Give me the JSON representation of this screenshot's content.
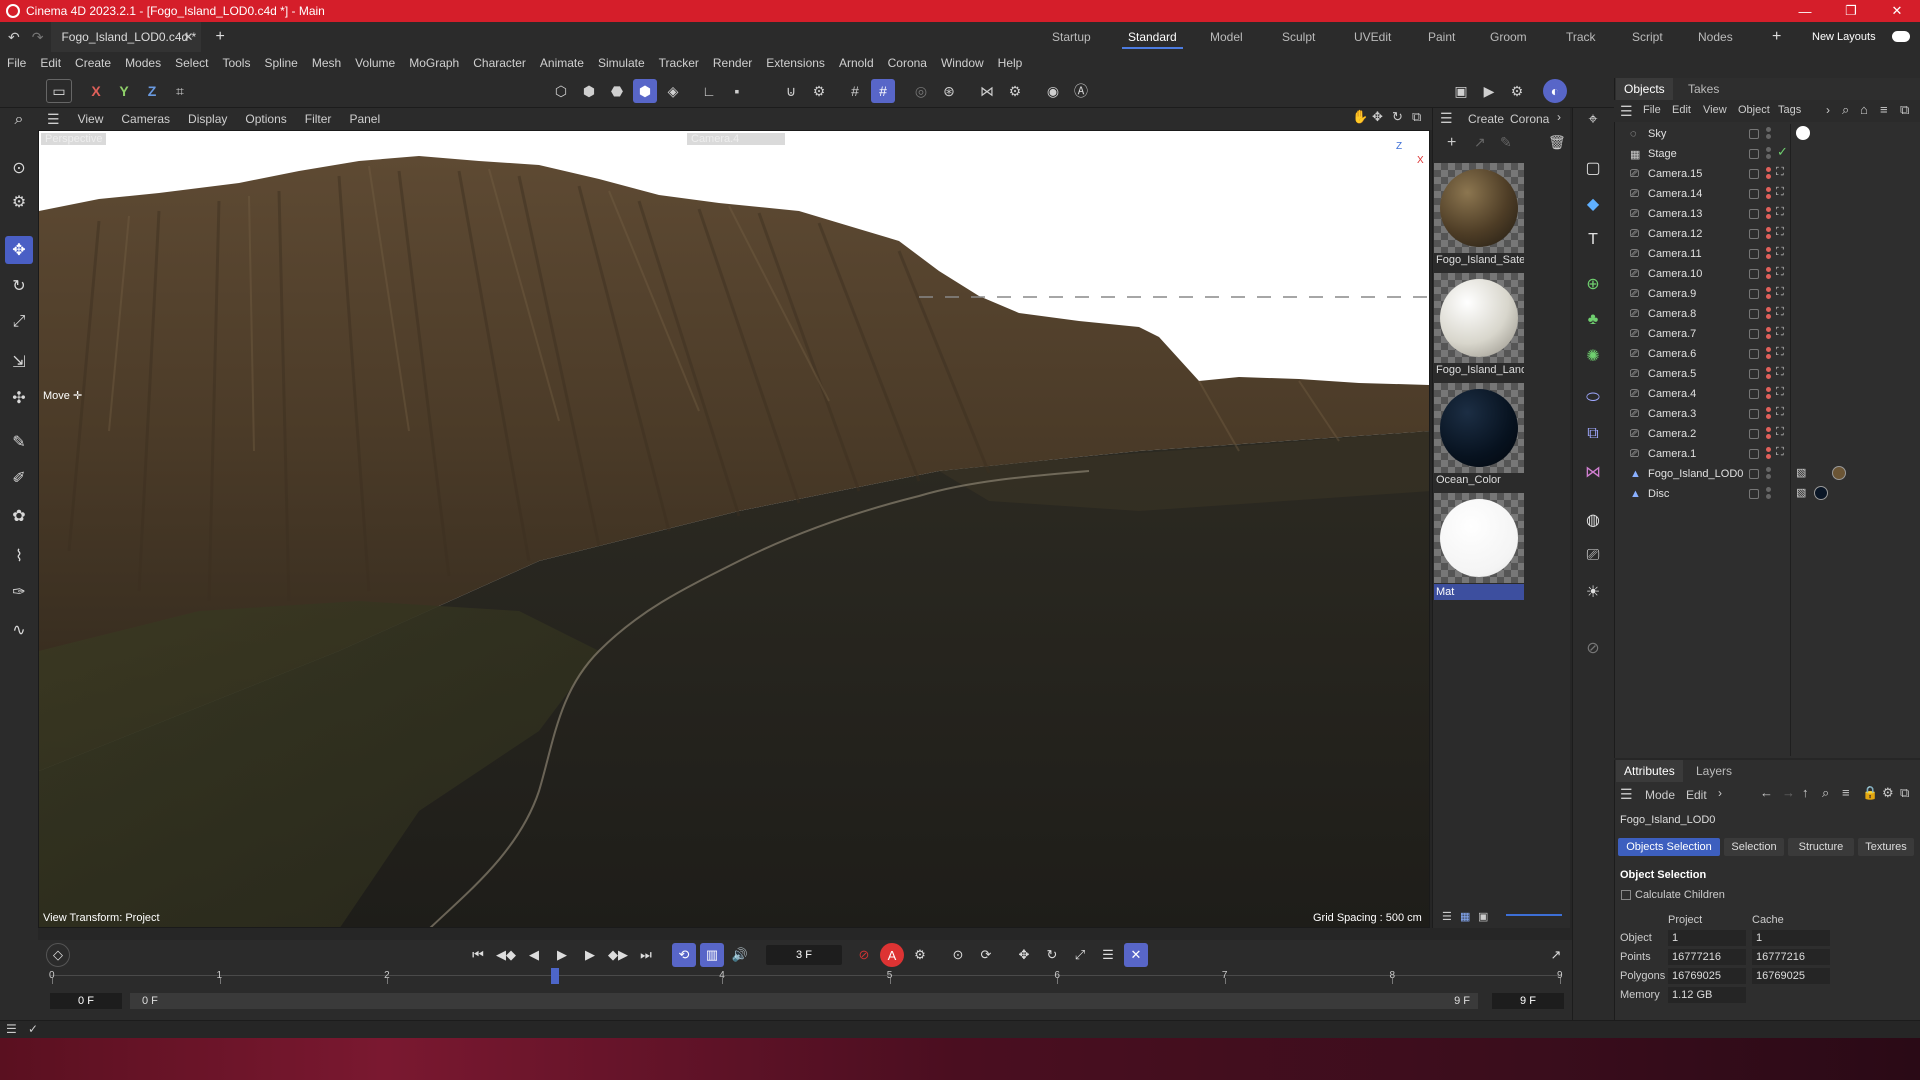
{
  "window": {
    "title": "Cinema 4D 2023.2.1 - [Fogo_Island_LOD0.c4d *] - Main",
    "minimize": "—",
    "maximize": "❐",
    "close": "✕"
  },
  "tabs": {
    "doc_tab": "Fogo_Island_LOD0.c4d *",
    "add": "+",
    "layouts": [
      "Startup",
      "Standard",
      "Model",
      "Sculpt",
      "UVEdit",
      "Paint",
      "Groom",
      "Track",
      "Script",
      "Nodes"
    ],
    "active_layout": "Standard",
    "new_layouts": "New Layouts"
  },
  "menu": [
    "File",
    "Edit",
    "Create",
    "Modes",
    "Select",
    "Tools",
    "Spline",
    "Mesh",
    "Volume",
    "MoGraph",
    "Character",
    "Animate",
    "Simulate",
    "Tracker",
    "Render",
    "Extensions",
    "Arnold",
    "Corona",
    "Window",
    "Help"
  ],
  "toolbar": {
    "axis_x": "X",
    "axis_y": "Y",
    "axis_z": "Z"
  },
  "viewport": {
    "menu": [
      "View",
      "Cameras",
      "Display",
      "Options",
      "Filter",
      "Panel"
    ],
    "perspective_label": "Perspective",
    "camera_label": "Camera.4",
    "tool_label": "Move ✛",
    "view_transform": "View Transform: Project",
    "grid_spacing": "Grid Spacing : 500 cm",
    "axis_z": "Z",
    "axis_x": "X"
  },
  "materials": {
    "menu": [
      "Create",
      "Corona"
    ],
    "items": [
      {
        "name": "Fogo_Island_Satel"
      },
      {
        "name": "Fogo_Island_Land"
      },
      {
        "name": "Ocean_Color"
      },
      {
        "name": "Mat"
      }
    ]
  },
  "objects": {
    "tabs": [
      "Objects",
      "Takes"
    ],
    "menu": [
      "File",
      "Edit",
      "View",
      "Object",
      "Tags"
    ],
    "items": [
      {
        "name": "Sky",
        "icon": "sky-icon"
      },
      {
        "name": "Stage",
        "icon": "stage-icon"
      },
      {
        "name": "Camera.15",
        "icon": "camera-icon"
      },
      {
        "name": "Camera.14",
        "icon": "camera-icon"
      },
      {
        "name": "Camera.13",
        "icon": "camera-icon"
      },
      {
        "name": "Camera.12",
        "icon": "camera-icon"
      },
      {
        "name": "Camera.11",
        "icon": "camera-icon"
      },
      {
        "name": "Camera.10",
        "icon": "camera-icon"
      },
      {
        "name": "Camera.9",
        "icon": "camera-icon"
      },
      {
        "name": "Camera.8",
        "icon": "camera-icon"
      },
      {
        "name": "Camera.7",
        "icon": "camera-icon"
      },
      {
        "name": "Camera.6",
        "icon": "camera-icon"
      },
      {
        "name": "Camera.5",
        "icon": "camera-icon"
      },
      {
        "name": "Camera.4",
        "icon": "camera-icon"
      },
      {
        "name": "Camera.3",
        "icon": "camera-icon"
      },
      {
        "name": "Camera.2",
        "icon": "camera-icon"
      },
      {
        "name": "Camera.1",
        "icon": "camera-icon"
      },
      {
        "name": "Fogo_Island_LOD0",
        "icon": "polygon-object-icon"
      },
      {
        "name": "Disc",
        "icon": "polygon-object-icon"
      }
    ]
  },
  "attributes": {
    "tabs": [
      "Attributes",
      "Layers"
    ],
    "menu": [
      "Mode",
      "Edit"
    ],
    "object_name": "Fogo_Island_LOD0",
    "buttons": [
      "Objects Selection",
      "Selection",
      "Structure",
      "Textures"
    ],
    "section": "Object Selection",
    "calc_children": "Calculate Children",
    "col_project": "Project",
    "col_cache": "Cache",
    "rows": [
      {
        "label": "Object",
        "project": "1",
        "cache": "1"
      },
      {
        "label": "Points",
        "project": "16777216",
        "cache": "16777216"
      },
      {
        "label": "Polygons",
        "project": "16769025",
        "cache": "16769025"
      },
      {
        "label": "Memory",
        "project": "1.12 GB",
        "cache": ""
      }
    ]
  },
  "timeline": {
    "current_frame": "3 F",
    "ticks": [
      "0",
      "1",
      "2",
      "3",
      "4",
      "5",
      "6",
      "7",
      "8",
      "9"
    ],
    "start": "0 F",
    "range_start": "0 F",
    "range_end": "9 F",
    "end": "9 F",
    "playhead_frame": 3,
    "frame_count": 9
  }
}
